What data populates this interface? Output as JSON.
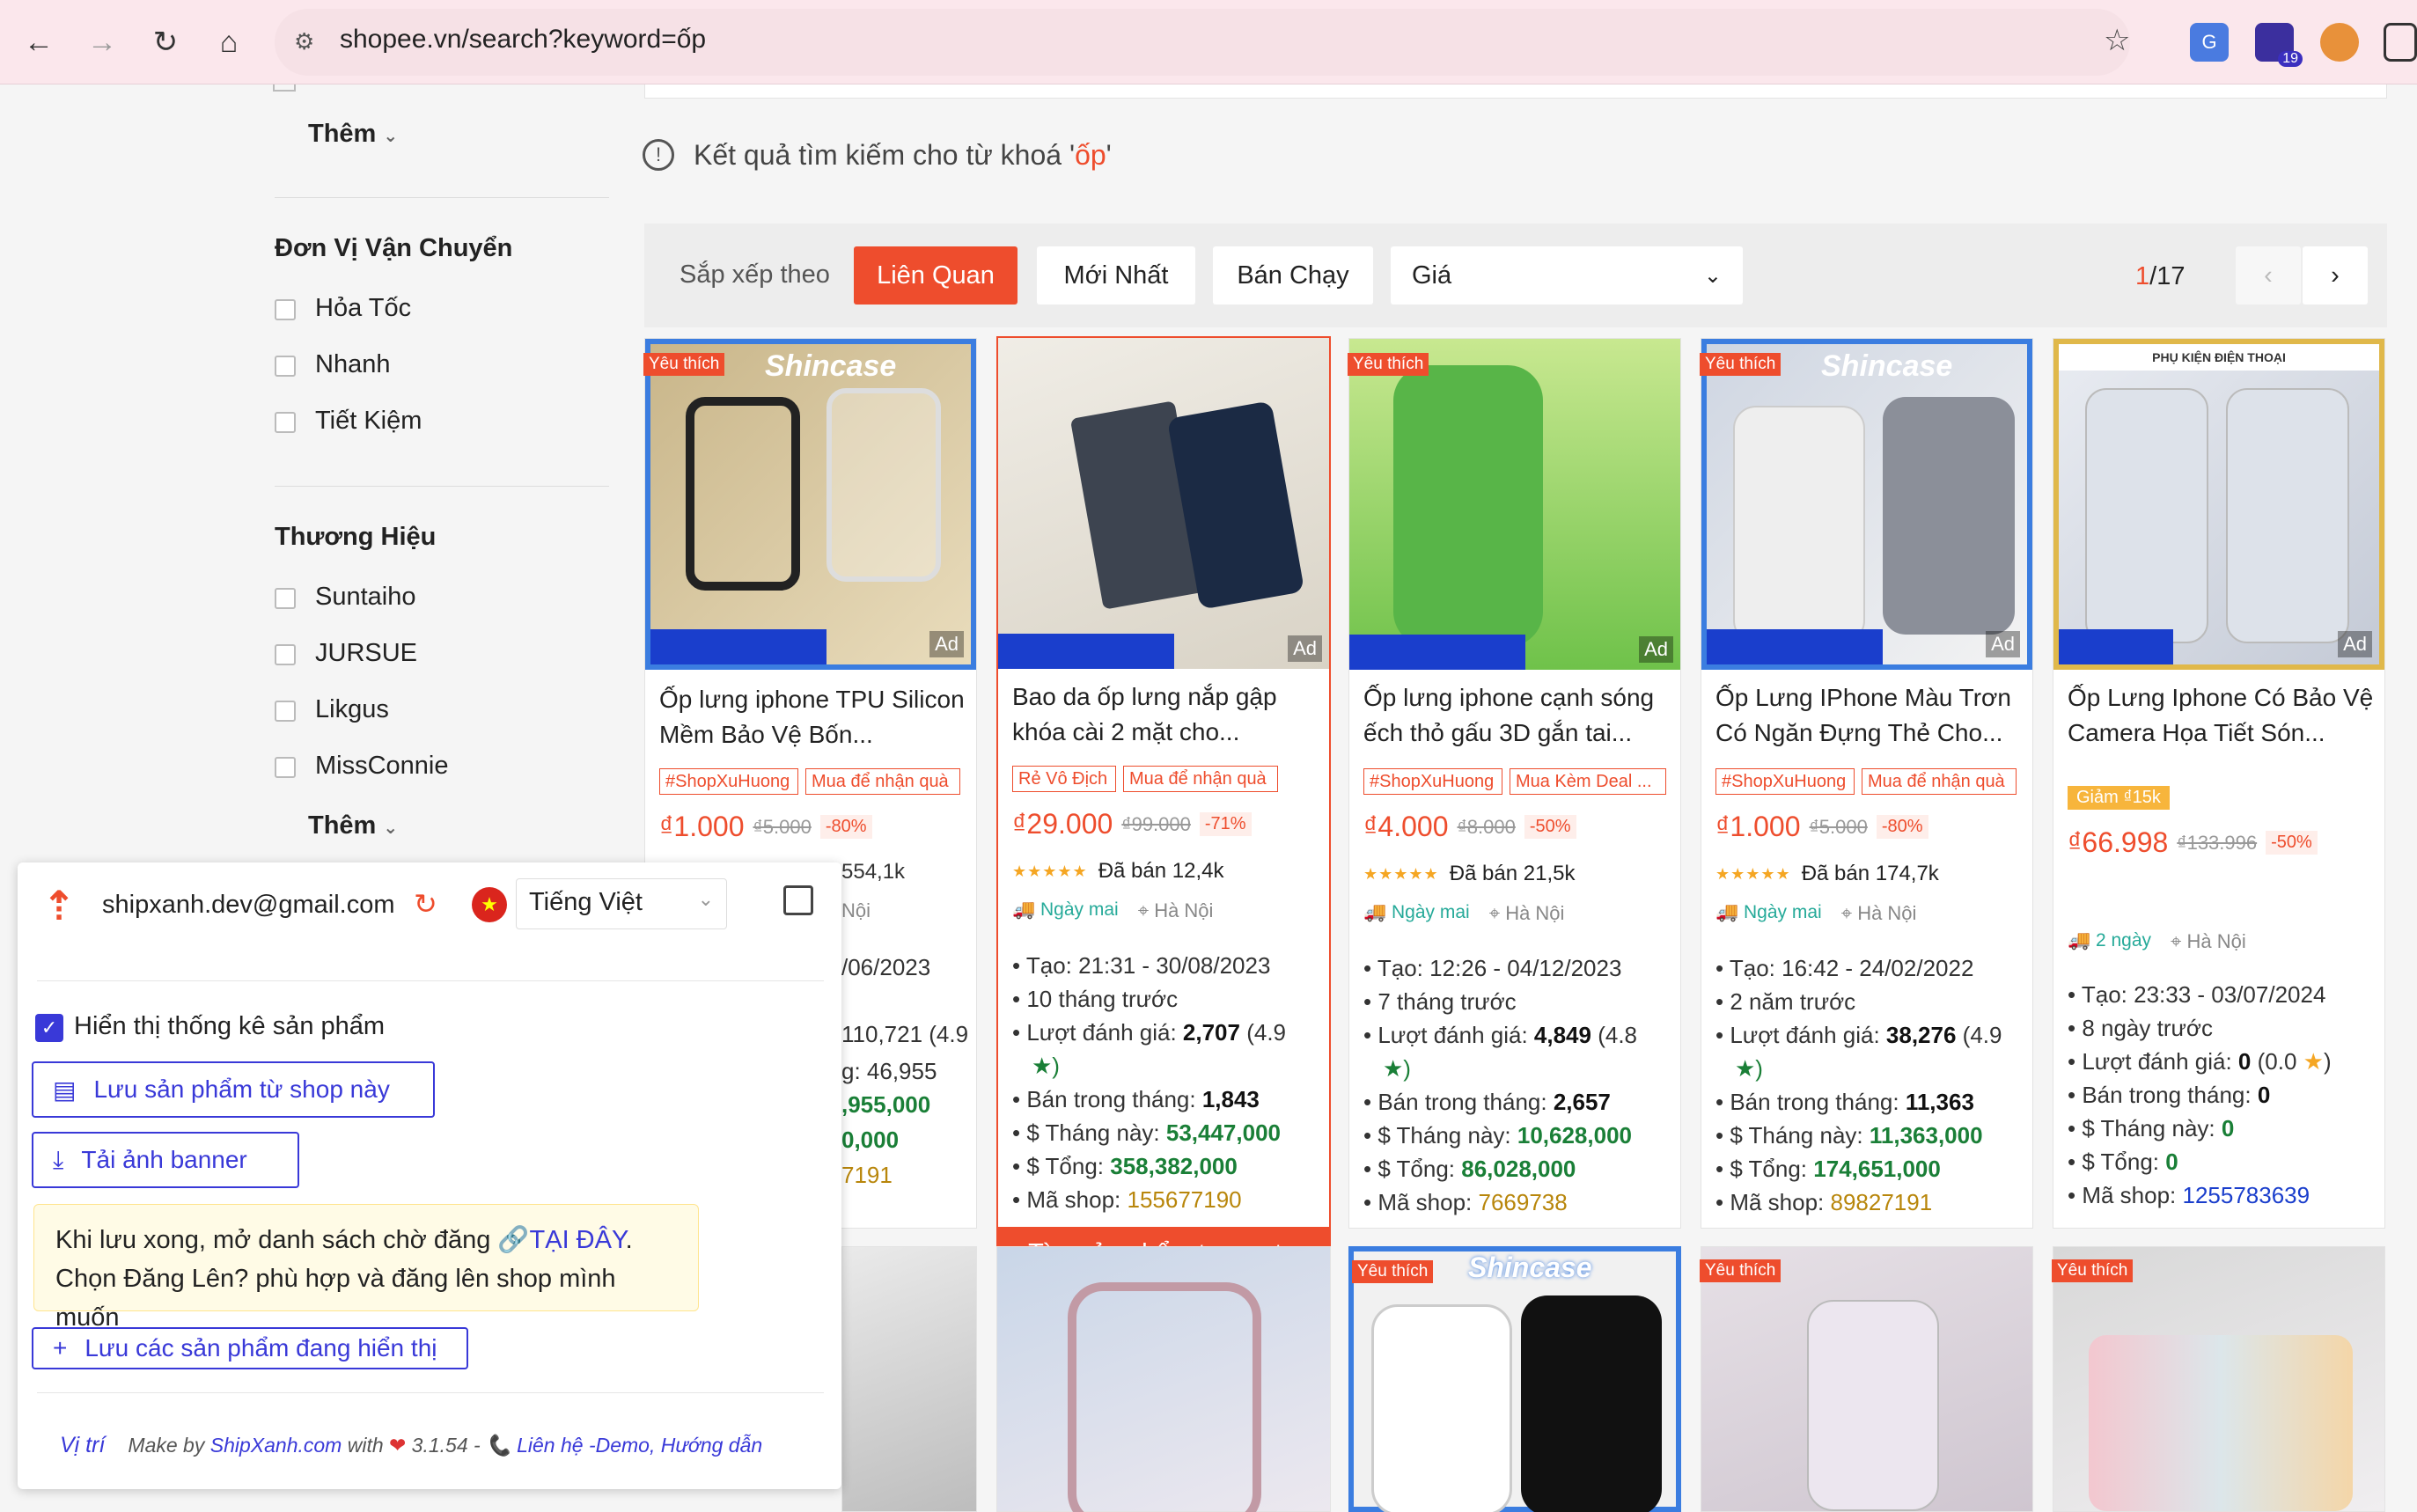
{
  "browser": {
    "url": "shopee.vn/search?keyword=ốp",
    "ext_badge": "19"
  },
  "sidebar": {
    "more_top": "Thêm",
    "shipping_title": "Đơn Vị Vận Chuyển",
    "shipping_options": [
      "Hỏa Tốc",
      "Nhanh",
      "Tiết Kiệm"
    ],
    "brand_title": "Thương Hiệu",
    "brand_options": [
      "Suntaiho",
      "JURSUE",
      "Likgus",
      "MissConnie"
    ],
    "more_bottom": "Thêm"
  },
  "search": {
    "result_prefix": "Kết quả tìm kiếm cho từ khoá '",
    "keyword": "ốp",
    "result_suffix": "'"
  },
  "sort": {
    "label": "Sắp xếp theo",
    "options": [
      "Liên Quan",
      "Mới Nhất",
      "Bán Chạy"
    ],
    "price_label": "Giá",
    "page_current": "1",
    "page_total": "/17"
  },
  "products": [
    {
      "title": "Ốp lưng iphone TPU Silicon Mềm Bảo Vệ Bốn...",
      "tag": "Yêu thích",
      "badges": [
        "#ShopXuHuong",
        "Mua để nhận quà"
      ],
      "price": "₫1.000",
      "old_price": "₫5.000",
      "discount": "-80%",
      "ad": "Ad",
      "brand_overlay": "Shincase"
    },
    {
      "title": "Bao da ốp lưng nắp gập khóa cài 2 mặt cho...",
      "badges": [
        "Rẻ Vô Địch",
        "Mua để nhận quà"
      ],
      "price": "₫29.000",
      "old_price": "₫99.000",
      "discount": "-71%",
      "sold": "Đã bán 12,4k",
      "ship": "Ngày mai",
      "location": "Hà Nội",
      "created": "Tạo: 21:31 - 30/08/2023",
      "ago": "10 tháng trước",
      "reviews_label": "Lượt đánh giá: ",
      "reviews": "2,707",
      "rating": "(4.9",
      "monthly_sold_label": "Bán trong tháng: ",
      "monthly_sold": "1,843",
      "monthly_rev_label": "$ Tháng này: ",
      "monthly_rev": "53,447,000",
      "total_label": "$ Tổng: ",
      "total": "358,382,000",
      "shop_label": "Mã shop: ",
      "shop": "155677190",
      "ad": "Ad",
      "similar": "Tìm sản phẩm tương tự"
    },
    {
      "title": "Ốp lưng iphone cạnh sóng ếch thỏ gấu 3D gắn tai...",
      "tag": "Yêu thích",
      "badges": [
        "#ShopXuHuong",
        "Mua Kèm Deal ..."
      ],
      "price": "₫4.000",
      "old_price": "₫8.000",
      "discount": "-50%",
      "sold": "Đã bán 21,5k",
      "ship": "Ngày mai",
      "location": "Hà Nội",
      "created": "Tạo: 12:26 - 04/12/2023",
      "ago": "7 tháng trước",
      "reviews_label": "Lượt đánh giá: ",
      "reviews": "4,849",
      "rating": "(4.8",
      "monthly_sold_label": "Bán trong tháng: ",
      "monthly_sold": "2,657",
      "monthly_rev_label": "$ Tháng này: ",
      "monthly_rev": "10,628,000",
      "total_label": "$ Tổng: ",
      "total": "86,028,000",
      "shop_label": "Mã shop: ",
      "shop": "7669738",
      "ad": "Ad"
    },
    {
      "title": "Ốp Lưng IPhone Màu Trơn Có Ngăn Đựng Thẻ Cho...",
      "tag": "Yêu thích",
      "badges": [
        "#ShopXuHuong",
        "Mua để nhận quà"
      ],
      "price": "₫1.000",
      "old_price": "₫5.000",
      "discount": "-80%",
      "sold": "Đã bán 174,7k",
      "ship": "Ngày mai",
      "location": "Hà Nội",
      "created": "Tạo: 16:42 - 24/02/2022",
      "ago": "2 năm trước",
      "reviews_label": "Lượt đánh giá: ",
      "reviews": "38,276",
      "rating": "(4.9",
      "monthly_sold_label": "Bán trong tháng: ",
      "monthly_sold": "11,363",
      "monthly_rev_label": "$ Tháng này: ",
      "monthly_rev": "11,363,000",
      "total_label": "$ Tổng: ",
      "total": "174,651,000",
      "shop_label": "Mã shop: ",
      "shop": "89827191",
      "ad": "Ad",
      "brand_overlay": "Shincase"
    },
    {
      "title": "Ốp Lưng Iphone Có Bảo Vệ Camera Họa Tiết Són...",
      "voucher": "Giảm ₫15k",
      "price": "₫66.998",
      "old_price": "₫133.996",
      "discount": "-50%",
      "ship": "2 ngày",
      "location": "Hà Nội",
      "created": "Tạo: 23:33 - 03/07/2024",
      "ago": "8 ngày trước",
      "reviews_label": "Lượt đánh giá: ",
      "reviews": "0",
      "rating": "(0.0",
      "monthly_sold_label": "Bán trong tháng: ",
      "monthly_sold": "0",
      "monthly_rev_label": "$ Tháng này: ",
      "monthly_rev": "0",
      "total_label": "$ Tổng: ",
      "total": "0",
      "shop_label": "Mã shop: ",
      "shop": "1255783639",
      "ad": "Ad",
      "shop_banner": "PHỤ KIỆN ĐIỆN THOẠI"
    }
  ],
  "partial_stats": {
    "sold": "554,1k",
    "location": "Nội",
    "date": "/06/2023",
    "reviews": "110,721 (4.9",
    "monthly": "g: 46,955",
    "monthly_rev": ",955,000",
    "total": "0,000",
    "shop": "7191"
  },
  "second_row_tags": [
    "Yêu thích",
    "Yêu thích",
    "Yêu thích"
  ],
  "second_row_brand": "Shincase",
  "extension": {
    "email": "shipxanh.dev@gmail.com",
    "language": "Tiếng Việt",
    "show_stats": "Hiển thị thống kê sản phẩm",
    "save_shop": "Lưu sản phẩm từ shop này",
    "download_banner": "Tải ảnh banner",
    "note_line1": "Khi lưu xong, mở danh sách chờ đăng ",
    "note_link": "TẠI ĐÂY",
    "note_line1_end": ".",
    "note_line2": "Chọn Đăng Lên? phù hợp và đăng lên shop mình muốn",
    "save_visible": "Lưu các sản phẩm đang hiển thị",
    "footer_position": "Vị trí",
    "footer_make": "Make by ",
    "footer_brand": "ShipXanh.com",
    "footer_with": " with ",
    "footer_version": " 3.1.54 - ",
    "footer_contact": "Liên hệ -Demo, Hướng dẫn"
  },
  "colors": {
    "shopee_orange": "#ee4d2d",
    "extension_blue": "#3939d8"
  }
}
